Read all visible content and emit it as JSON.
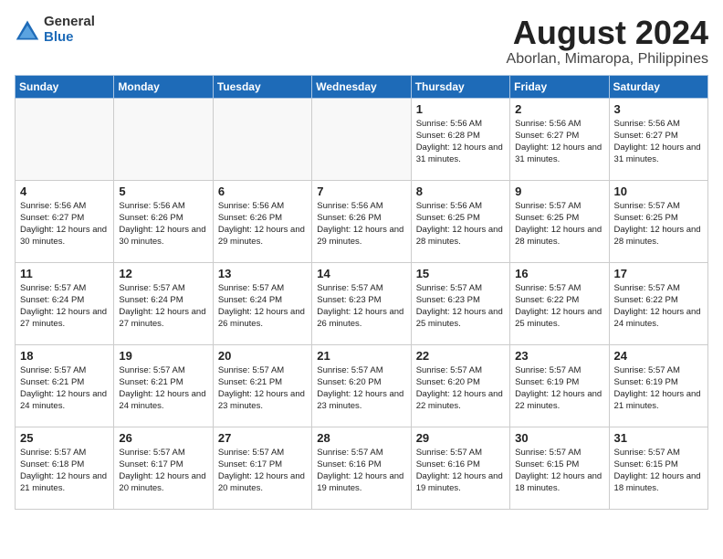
{
  "logo": {
    "general": "General",
    "blue": "Blue"
  },
  "title": "August 2024",
  "subtitle": "Aborlan, Mimaropa, Philippines",
  "weekdays": [
    "Sunday",
    "Monday",
    "Tuesday",
    "Wednesday",
    "Thursday",
    "Friday",
    "Saturday"
  ],
  "weeks": [
    [
      {
        "day": "",
        "info": ""
      },
      {
        "day": "",
        "info": ""
      },
      {
        "day": "",
        "info": ""
      },
      {
        "day": "",
        "info": ""
      },
      {
        "day": "1",
        "info": "Sunrise: 5:56 AM\nSunset: 6:28 PM\nDaylight: 12 hours\nand 31 minutes."
      },
      {
        "day": "2",
        "info": "Sunrise: 5:56 AM\nSunset: 6:27 PM\nDaylight: 12 hours\nand 31 minutes."
      },
      {
        "day": "3",
        "info": "Sunrise: 5:56 AM\nSunset: 6:27 PM\nDaylight: 12 hours\nand 31 minutes."
      }
    ],
    [
      {
        "day": "4",
        "info": "Sunrise: 5:56 AM\nSunset: 6:27 PM\nDaylight: 12 hours\nand 30 minutes."
      },
      {
        "day": "5",
        "info": "Sunrise: 5:56 AM\nSunset: 6:26 PM\nDaylight: 12 hours\nand 30 minutes."
      },
      {
        "day": "6",
        "info": "Sunrise: 5:56 AM\nSunset: 6:26 PM\nDaylight: 12 hours\nand 29 minutes."
      },
      {
        "day": "7",
        "info": "Sunrise: 5:56 AM\nSunset: 6:26 PM\nDaylight: 12 hours\nand 29 minutes."
      },
      {
        "day": "8",
        "info": "Sunrise: 5:56 AM\nSunset: 6:25 PM\nDaylight: 12 hours\nand 28 minutes."
      },
      {
        "day": "9",
        "info": "Sunrise: 5:57 AM\nSunset: 6:25 PM\nDaylight: 12 hours\nand 28 minutes."
      },
      {
        "day": "10",
        "info": "Sunrise: 5:57 AM\nSunset: 6:25 PM\nDaylight: 12 hours\nand 28 minutes."
      }
    ],
    [
      {
        "day": "11",
        "info": "Sunrise: 5:57 AM\nSunset: 6:24 PM\nDaylight: 12 hours\nand 27 minutes."
      },
      {
        "day": "12",
        "info": "Sunrise: 5:57 AM\nSunset: 6:24 PM\nDaylight: 12 hours\nand 27 minutes."
      },
      {
        "day": "13",
        "info": "Sunrise: 5:57 AM\nSunset: 6:24 PM\nDaylight: 12 hours\nand 26 minutes."
      },
      {
        "day": "14",
        "info": "Sunrise: 5:57 AM\nSunset: 6:23 PM\nDaylight: 12 hours\nand 26 minutes."
      },
      {
        "day": "15",
        "info": "Sunrise: 5:57 AM\nSunset: 6:23 PM\nDaylight: 12 hours\nand 25 minutes."
      },
      {
        "day": "16",
        "info": "Sunrise: 5:57 AM\nSunset: 6:22 PM\nDaylight: 12 hours\nand 25 minutes."
      },
      {
        "day": "17",
        "info": "Sunrise: 5:57 AM\nSunset: 6:22 PM\nDaylight: 12 hours\nand 24 minutes."
      }
    ],
    [
      {
        "day": "18",
        "info": "Sunrise: 5:57 AM\nSunset: 6:21 PM\nDaylight: 12 hours\nand 24 minutes."
      },
      {
        "day": "19",
        "info": "Sunrise: 5:57 AM\nSunset: 6:21 PM\nDaylight: 12 hours\nand 24 minutes."
      },
      {
        "day": "20",
        "info": "Sunrise: 5:57 AM\nSunset: 6:21 PM\nDaylight: 12 hours\nand 23 minutes."
      },
      {
        "day": "21",
        "info": "Sunrise: 5:57 AM\nSunset: 6:20 PM\nDaylight: 12 hours\nand 23 minutes."
      },
      {
        "day": "22",
        "info": "Sunrise: 5:57 AM\nSunset: 6:20 PM\nDaylight: 12 hours\nand 22 minutes."
      },
      {
        "day": "23",
        "info": "Sunrise: 5:57 AM\nSunset: 6:19 PM\nDaylight: 12 hours\nand 22 minutes."
      },
      {
        "day": "24",
        "info": "Sunrise: 5:57 AM\nSunset: 6:19 PM\nDaylight: 12 hours\nand 21 minutes."
      }
    ],
    [
      {
        "day": "25",
        "info": "Sunrise: 5:57 AM\nSunset: 6:18 PM\nDaylight: 12 hours\nand 21 minutes."
      },
      {
        "day": "26",
        "info": "Sunrise: 5:57 AM\nSunset: 6:17 PM\nDaylight: 12 hours\nand 20 minutes."
      },
      {
        "day": "27",
        "info": "Sunrise: 5:57 AM\nSunset: 6:17 PM\nDaylight: 12 hours\nand 20 minutes."
      },
      {
        "day": "28",
        "info": "Sunrise: 5:57 AM\nSunset: 6:16 PM\nDaylight: 12 hours\nand 19 minutes."
      },
      {
        "day": "29",
        "info": "Sunrise: 5:57 AM\nSunset: 6:16 PM\nDaylight: 12 hours\nand 19 minutes."
      },
      {
        "day": "30",
        "info": "Sunrise: 5:57 AM\nSunset: 6:15 PM\nDaylight: 12 hours\nand 18 minutes."
      },
      {
        "day": "31",
        "info": "Sunrise: 5:57 AM\nSunset: 6:15 PM\nDaylight: 12 hours\nand 18 minutes."
      }
    ]
  ]
}
